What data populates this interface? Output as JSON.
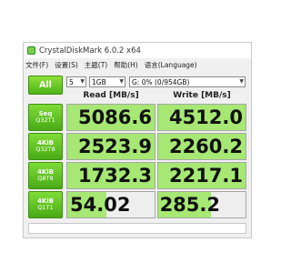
{
  "window": {
    "title": "CrystalDiskMark 6.0.2 x64"
  },
  "menu": [
    "文件(F)",
    "设置(S)",
    "主题(T)",
    "帮助(H)",
    "语言(Language)"
  ],
  "controls": {
    "all_label": "All",
    "count": "5",
    "size": "1GB",
    "drive": "G: 0% (0/954GB)"
  },
  "headers": {
    "read": "Read [MB/s]",
    "write": "Write [MB/s]"
  },
  "rows": [
    {
      "line1": "Seq",
      "line2": "Q32T1",
      "read": "5086.6",
      "write": "4512.0",
      "read_fill": 1.0,
      "write_fill": 1.0
    },
    {
      "line1": "4KiB",
      "line2": "Q32T8",
      "read": "2523.9",
      "write": "2260.2",
      "read_fill": 1.0,
      "write_fill": 1.0
    },
    {
      "line1": "4KiB",
      "line2": "Q8T8",
      "read": "1732.3",
      "write": "2217.1",
      "read_fill": 1.0,
      "write_fill": 1.0
    },
    {
      "line1": "4KiB",
      "line2": "Q1T1",
      "read": "54.02",
      "write": "285.2",
      "read_fill": 0.45,
      "write_fill": 0.6
    }
  ],
  "colors": {
    "accent_green": "#4db318",
    "bar_green": "#a6e873"
  }
}
